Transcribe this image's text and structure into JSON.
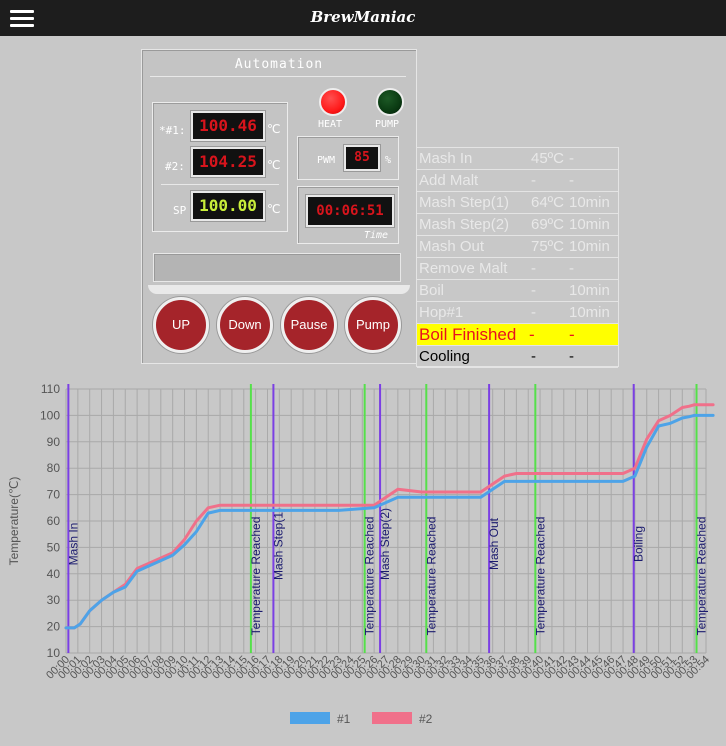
{
  "header": {
    "title": "BrewManiac",
    "menu_icon": "hamburger-menu-icon"
  },
  "panel": {
    "title": "Automation",
    "sensor1_label": "*#1:",
    "sensor1_value": "100.46",
    "sensor2_label": "#2:",
    "sensor2_value": "104.25",
    "unit": "℃",
    "sp_label": "SP",
    "sp_value": "100.00",
    "heat_label": "HEAT",
    "pump_label": "PUMP",
    "pwm_label": "PWM",
    "pwm_value": "85",
    "pwm_unit": "%",
    "timer_value": "00:06:51",
    "timer_label": "Time",
    "status_text": "",
    "colors": {
      "heat_led": "#ff1a1a",
      "pump_led": "#0a3a12",
      "button": "#a5242a",
      "lcd_red": "#d8141c",
      "lcd_green": "#c9ee3a"
    }
  },
  "buttons": {
    "up": "UP",
    "down": "Down",
    "pause": "Pause",
    "pump": "Pump"
  },
  "steps": [
    {
      "name": "Mash In",
      "temp": "45ºC",
      "time": "-",
      "state": "done"
    },
    {
      "name": "Add Malt",
      "temp": "-",
      "time": "-",
      "state": "done"
    },
    {
      "name": "Mash Step(1)",
      "temp": "64ºC",
      "time": "10min",
      "state": "done"
    },
    {
      "name": "Mash Step(2)",
      "temp": "69ºC",
      "time": "10min",
      "state": "done"
    },
    {
      "name": "Mash Out",
      "temp": "75ºC",
      "time": "10min",
      "state": "done"
    },
    {
      "name": "Remove Malt",
      "temp": "-",
      "time": "-",
      "state": "done"
    },
    {
      "name": "Boil",
      "temp": "-",
      "time": "10min",
      "state": "done"
    },
    {
      "name": "Hop#1",
      "temp": "-",
      "time": "10min",
      "state": "done"
    },
    {
      "name": "Boil Finished",
      "temp": "-",
      "time": "-",
      "state": "current"
    },
    {
      "name": "Cooling",
      "temp": "-",
      "time": "-",
      "state": "pending"
    }
  ],
  "chart_data": {
    "type": "line",
    "ylabel": "Temperature(℃)",
    "xlabel": "",
    "ylim": [
      10,
      110
    ],
    "yticks": [
      10,
      20,
      30,
      40,
      50,
      60,
      70,
      80,
      90,
      100,
      110
    ],
    "xticks": [
      "00:00",
      "00:01",
      "00:02",
      "00:03",
      "00:04",
      "00:05",
      "00:06",
      "00:07",
      "00:08",
      "00:09",
      "00:10",
      "00:11",
      "00:12",
      "00:13",
      "00:14",
      "00:15",
      "00:16",
      "00:17",
      "00:18",
      "00:19",
      "00:20",
      "00:21",
      "00:22",
      "00:23",
      "00:24",
      "00:25",
      "00:26",
      "00:27",
      "00:28",
      "00:29",
      "00:30",
      "00:31",
      "00:32",
      "00:33",
      "00:34",
      "00:35",
      "00:36",
      "00:37",
      "00:38",
      "00:39",
      "00:40",
      "00:41",
      "00:42",
      "00:43",
      "00:44",
      "00:45",
      "00:46",
      "00:47",
      "00:48",
      "00:49",
      "00:50",
      "00:51",
      "00:52",
      "00:53",
      "00:54"
    ],
    "grid": true,
    "legend_position": "bottom",
    "series": [
      {
        "name": "#1",
        "color": "#4da3e8",
        "x": [
          0,
          0.7,
          1.2,
          2,
          3,
          4,
          5,
          5.5,
          6,
          7,
          8,
          9,
          10,
          11,
          12,
          13,
          14,
          18,
          23,
          26,
          28,
          30,
          33,
          35,
          36,
          37,
          38,
          40,
          42,
          44,
          46,
          47,
          48,
          49,
          50,
          51,
          52,
          52.6,
          53,
          54,
          54.6
        ],
        "y": [
          19.5,
          19.5,
          21,
          26,
          30,
          33,
          35,
          38,
          41,
          43,
          45,
          47,
          51,
          56,
          63,
          64,
          64,
          64,
          64,
          65,
          69,
          69,
          69,
          69,
          72,
          75,
          75,
          75,
          75,
          75,
          75,
          75,
          77,
          88,
          96,
          97,
          99,
          99.5,
          100,
          100,
          100
        ]
      },
      {
        "name": "#2",
        "color": "#f0708a",
        "x": [
          0,
          0.7,
          1.2,
          2,
          3,
          4,
          5,
          5.5,
          6,
          7,
          8,
          9,
          10,
          11,
          12,
          13,
          14,
          18,
          23,
          26,
          28,
          30,
          33,
          35,
          36,
          37,
          38,
          40,
          42,
          44,
          46,
          47,
          48,
          49,
          50,
          51,
          52,
          52.6,
          53,
          54,
          54.6
        ],
        "y": [
          19.5,
          19.5,
          21,
          26,
          30,
          33,
          36,
          39,
          42,
          44,
          46,
          48,
          53,
          60,
          65,
          66,
          66,
          66,
          66,
          66,
          72,
          71,
          71,
          71,
          74,
          77,
          78,
          78,
          78,
          78,
          78,
          78,
          80,
          91,
          98,
          100,
          103,
          103.5,
          104,
          104,
          104
        ]
      }
    ],
    "markers": [
      {
        "x": 0.2,
        "label": "Mash In",
        "kind": "step",
        "color": "#7b3fe4"
      },
      {
        "x": 15.6,
        "label": "Temperature Reached",
        "kind": "reached",
        "color": "#55e04a"
      },
      {
        "x": 17.5,
        "label": "Mash Step(1)",
        "kind": "step",
        "color": "#7b3fe4"
      },
      {
        "x": 25.2,
        "label": "Temperature Reached",
        "kind": "reached",
        "color": "#55e04a"
      },
      {
        "x": 26.5,
        "label": "Mash Step(2)",
        "kind": "step",
        "color": "#7b3fe4"
      },
      {
        "x": 30.4,
        "label": "Temperature Reached",
        "kind": "reached",
        "color": "#55e04a"
      },
      {
        "x": 35.7,
        "label": "Mash Out",
        "kind": "step",
        "color": "#7b3fe4"
      },
      {
        "x": 39.6,
        "label": "Temperature Reached",
        "kind": "reached",
        "color": "#55e04a"
      },
      {
        "x": 47.9,
        "label": "Boiling",
        "kind": "step",
        "color": "#7b3fe4"
      },
      {
        "x": 53.2,
        "label": "Temperature Reached",
        "kind": "reached",
        "color": "#55e04a"
      }
    ]
  }
}
